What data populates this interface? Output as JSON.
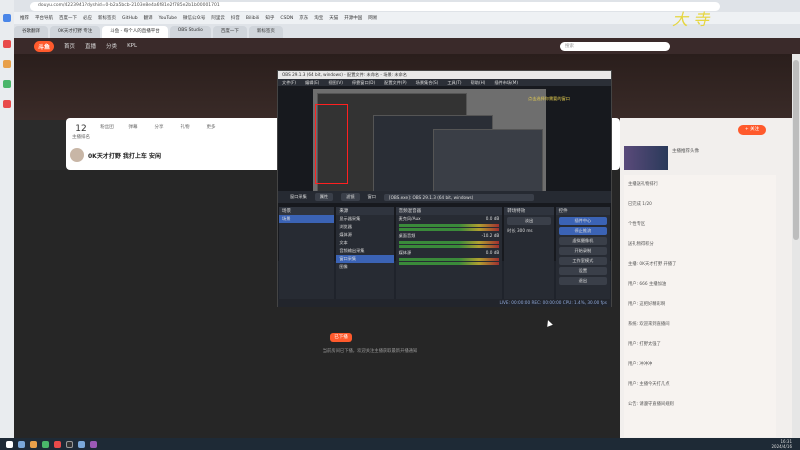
{
  "browser": {
    "url": "douyu.com/4223941?dyshid=0-b2a5bcb-2103e8e4a6f81e2f785e2b1b00001701",
    "bookmarks": [
      "推荐",
      "平台导航",
      "百度一下",
      "必应",
      "新标签页",
      "GitHub",
      "翻译",
      "YouTube",
      "微信公众号",
      "阿里云",
      "抖音",
      "Bilibili",
      "知乎",
      "CSDN",
      "京东",
      "淘宝",
      "天猫",
      "开源中国",
      "网易"
    ],
    "tabs": [
      "谷歌翻译",
      "0K天才打野 专注",
      "斗鱼 - 每个人的直播平台",
      "OBS Studio",
      "百度一下",
      "新标签页"
    ]
  },
  "site": {
    "logo": "斗鱼",
    "nav": [
      "首页",
      "直播",
      "分类",
      "KPL"
    ],
    "search_placeholder": "搜索",
    "follow_label": "+ 关注",
    "room_title": "0K天才打野 我打上车 安闲",
    "stats": [
      {
        "big": "12",
        "label": "主播排名"
      },
      {
        "big": "",
        "label": "粉丝团"
      },
      {
        "big": "",
        "label": "弹幕"
      },
      {
        "big": "",
        "label": "分享"
      },
      {
        "big": "",
        "label": "礼物"
      },
      {
        "big": "",
        "label": "更多"
      }
    ],
    "offline_label": "已下播",
    "offline_note": "当前房间已下播，欢迎关注主播获取最新开播通知"
  },
  "chat": {
    "pref_ad": "主播推荐头像",
    "lines": [
      "主播送礼物排行",
      "已完成 1/20",
      "个性专区",
      "送礼物得积分",
      "主播: 0K天才打野 开播了",
      "用户: 666 主播加油",
      "用户: 这把好精彩啊",
      "系统: 欢迎来到直播间",
      "用户: 打野太强了",
      "用户: 冲冲冲",
      "用户: 主播今天打几点",
      "公告: 请遵守直播间规则"
    ]
  },
  "obs": {
    "title": "OBS 29.1.3 (64 bit, windows) - 配置文件: 未命名 - 场景: 未命名",
    "menu": [
      "文件(F)",
      "编辑(E)",
      "视图(V)",
      "停靠窗口(D)",
      "配置文件(P)",
      "场景集合(S)",
      "工具(T)",
      "帮助(H)",
      "插件市场(M)"
    ],
    "notice": "点击选择你需要的窗口",
    "size_label": "284 px",
    "source_bar": [
      "窗口采集",
      "属性",
      "滤镜",
      "窗口",
      "[OBS.exe]: OBS 29.1.3 (64 bit, windows)"
    ],
    "docks": {
      "scenes_title": "场景",
      "scene_item": "场景",
      "sources_title": "来源",
      "sources": [
        "显示器采集",
        "浏览器",
        "媒体源",
        "文本",
        "音频输出采集",
        "窗口采集",
        "图像"
      ],
      "mixer_title": "音频混音器",
      "mixer": [
        {
          "name": "麦克风/Aux",
          "db": "0.0 dB"
        },
        {
          "name": "桌面音频",
          "db": "-10.2 dB"
        },
        {
          "name": "媒体源",
          "db": "0.0 dB"
        }
      ],
      "transition_title": "转场特效",
      "transition_value": "淡出",
      "duration_label": "时长",
      "duration_value": "300 ms",
      "controls_title": "控件",
      "controls": [
        "插件中心",
        "停止推流",
        "虚拟摄像机",
        "开始录制",
        "工作室模式",
        "设置",
        "退出"
      ]
    },
    "status": "LIVE: 00:00:00   REC: 00:00:00   CPU: 1.4%, 30.00 fps"
  },
  "taskbar": {
    "time": "16:31",
    "date": "2024/4/16"
  }
}
